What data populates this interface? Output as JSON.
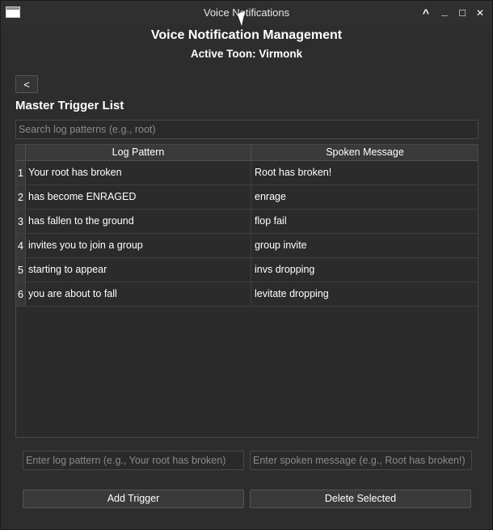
{
  "window": {
    "title": "Voice Notifications",
    "controls": {
      "chevron": "^",
      "minimize": "_",
      "maximize": "□",
      "close": "✕"
    }
  },
  "header": {
    "title": "Voice Notification Management",
    "subtitle": "Active Toon: Virmonk"
  },
  "nav": {
    "back_label": "<"
  },
  "section": {
    "title": "Master Trigger List"
  },
  "search": {
    "placeholder": "Search log patterns (e.g., root)"
  },
  "table": {
    "columns": [
      "Log Pattern",
      "Spoken Message"
    ],
    "rows": [
      {
        "num": "1",
        "pattern": "Your root has broken",
        "message": "Root has broken!"
      },
      {
        "num": "2",
        "pattern": "has become ENRAGED",
        "message": "enrage"
      },
      {
        "num": "3",
        "pattern": "has fallen to the ground",
        "message": "flop fail"
      },
      {
        "num": "4",
        "pattern": "invites you to join a group",
        "message": "group invite"
      },
      {
        "num": "5",
        "pattern": "starting to appear",
        "message": "invs dropping"
      },
      {
        "num": "6",
        "pattern": "you are about to fall",
        "message": "levitate dropping"
      }
    ]
  },
  "form": {
    "pattern_placeholder": "Enter log pattern (e.g., Your root has broken)",
    "message_placeholder": "Enter spoken message (e.g., Root has broken!)",
    "add_label": "Add Trigger",
    "delete_label": "Delete Selected"
  }
}
